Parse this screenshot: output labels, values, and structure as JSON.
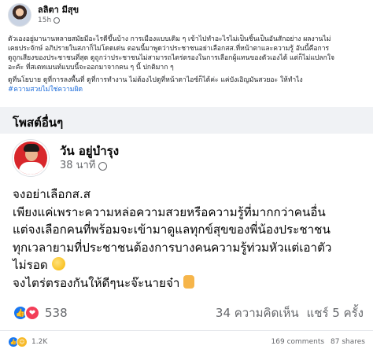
{
  "top_post": {
    "author": "ลลิตา มีสุข",
    "time": "15h",
    "paragraphs": [
      "ตัวเองอยู่มานานหลายสมัยมีอะไรดีขึ้นบ้าง การเมืองแบบเดิม ๆ เข้าไปทำอะไรไม่เป็นชิ้นเป็นอันสักอย่าง ผลงานไม่",
      "เคยประจักษ์ อภิปรายในสภาก็ไม่โดดเด่น ตอนนี้มาพูดว่าประชาชนอย่าเลือกสส.ที่หน้าตาและความรู้ อันนี้คือการ",
      "ดูถูกเสียงของประชาชนที่สุด ดูถูกว่าประชาชนไม่สามารถไตร่ตรองในการเลือกผู้แทนของตัวเองได้ แต่ก็ไม่แปลกใจ",
      "อะคัะ ที่สเตทเมนท์แบบนี้จะออกมาจากคน ๆ นี้ ปกติมาก ๆ"
    ],
    "paragraph2": "ดูที่นโยบาย ดูที่การลงพื้นที่ ดูที่การทำงาน ไม่ต้องไปดูที่หน้าตาไอซ์ก็ได้ค่ะ แค่บังเอิญมันสวยอะ ให้ทำไง",
    "hashtag": "#ความสวยไม่ใช่ความผิด"
  },
  "section_title": "โพสต์อื่นๆ",
  "post": {
    "author": "วัน อยู่บำรุง",
    "time": "38 นาที",
    "lines": [
      "จงอย่าเลือกส.ส",
      "เพียงแค่เพราะความหล่อความสวยหรือความรู้ที่มากกว่าคนอื่น",
      "แต่จงเลือกคนที่พร้อมจะเข้ามาดูแลทุกข์สุขของพี่น้องประชาชน",
      "ทุกเวลายามที่ประชาชนต้องการบางคนความรู้ท่วมหัวแต่เอาตัว",
      "ไม่รอด",
      "จงไตร่ตรองกันให้ดีๆนะจ๊ะนายจ๋า"
    ],
    "reaction_count": "538",
    "comments": "34 ความคิดเห็น",
    "shares": "แชร์ 5 ครั้ง"
  },
  "bottom": {
    "reaction_count": "1.2K",
    "comments": "169 comments",
    "shares": "87 shares"
  },
  "colors": {
    "link": "#216fdb",
    "like": "#1877f2",
    "love": "#f33e58",
    "avatar_bg": "#d8262b"
  }
}
